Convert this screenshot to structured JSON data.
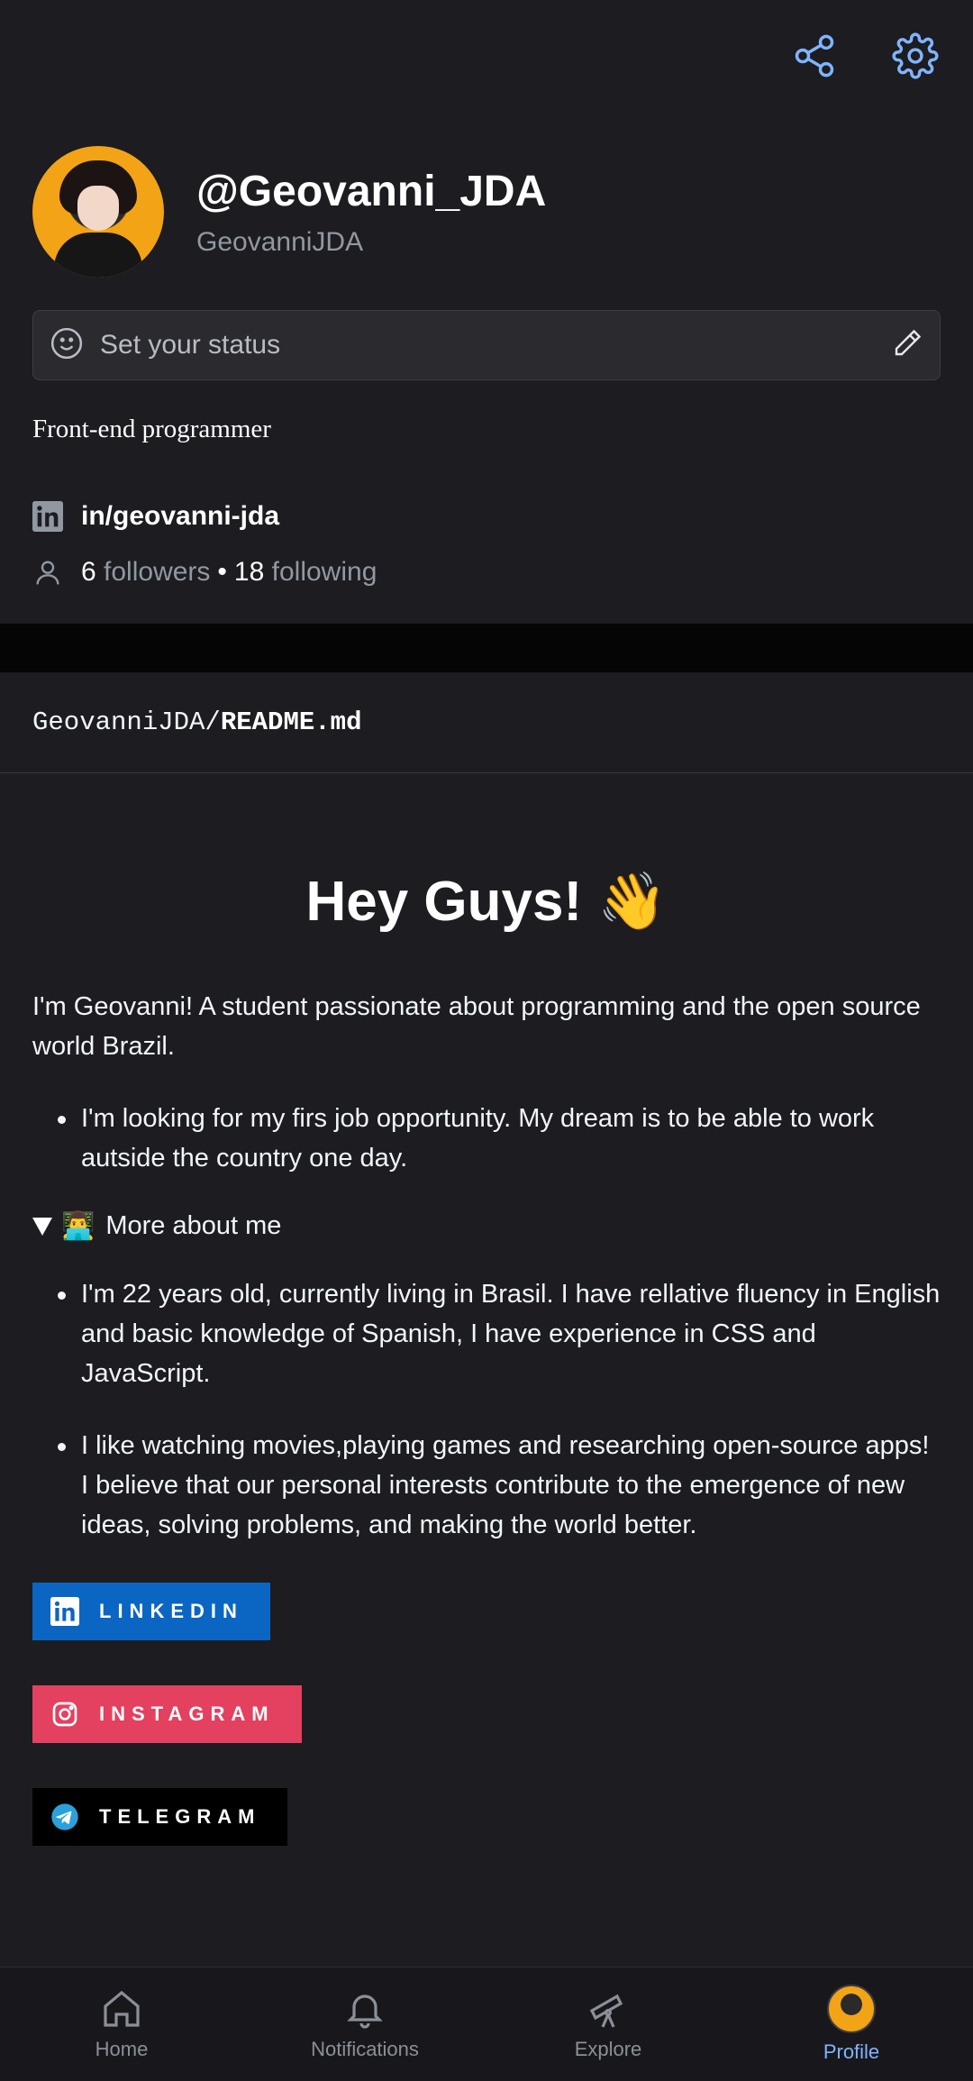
{
  "header": {
    "share_icon": "share-icon",
    "settings_icon": "gear-icon"
  },
  "profile": {
    "handle": "@Geovanni_JDA",
    "login": "GeovanniJDA",
    "bio": "Front-end programmer"
  },
  "status": {
    "placeholder": "Set your status"
  },
  "links": {
    "linkedin": "in/geovanni-jda"
  },
  "social": {
    "followers_count": "6",
    "followers_label": "followers",
    "separator": "•",
    "following_count": "18",
    "following_label": "following"
  },
  "readme": {
    "owner": "GeovanniJDA/",
    "file": "README.md",
    "heading": "Hey Guys! 👋",
    "intro": "I'm Geovanni! A student passionate about programming and the open source world Brazil.",
    "list1": [
      "I'm looking for my firs job opportunity. My dream is to be able to work autside the country one day."
    ],
    "details_emoji": "👨‍💻",
    "details_summary": "More about me",
    "list2": [
      "I'm 22 years old, currently living in Brasil. I have rellative fluency in English and basic knowledge of Spanish, I have experience in CSS and JavaScript.",
      "I like watching movies,playing games and researching open-source apps! I believe that our personal interests contribute to the emergence of new ideas, solving problems, and making the world better."
    ],
    "badges": [
      {
        "label": "LINKEDIN",
        "color": "#0a66c2"
      },
      {
        "label": "INSTAGRAM",
        "color": "#e4405f"
      },
      {
        "label": "TELEGRAM",
        "color": "#000000"
      }
    ]
  },
  "nav": {
    "items": [
      {
        "label": "Home",
        "icon": "home-icon"
      },
      {
        "label": "Notifications",
        "icon": "bell-icon"
      },
      {
        "label": "Explore",
        "icon": "telescope-icon"
      },
      {
        "label": "Profile",
        "icon": "avatar",
        "active": true
      }
    ]
  },
  "colors": {
    "background": "#1c1c21",
    "accent": "#80b4ff",
    "muted": "#9198a1"
  }
}
